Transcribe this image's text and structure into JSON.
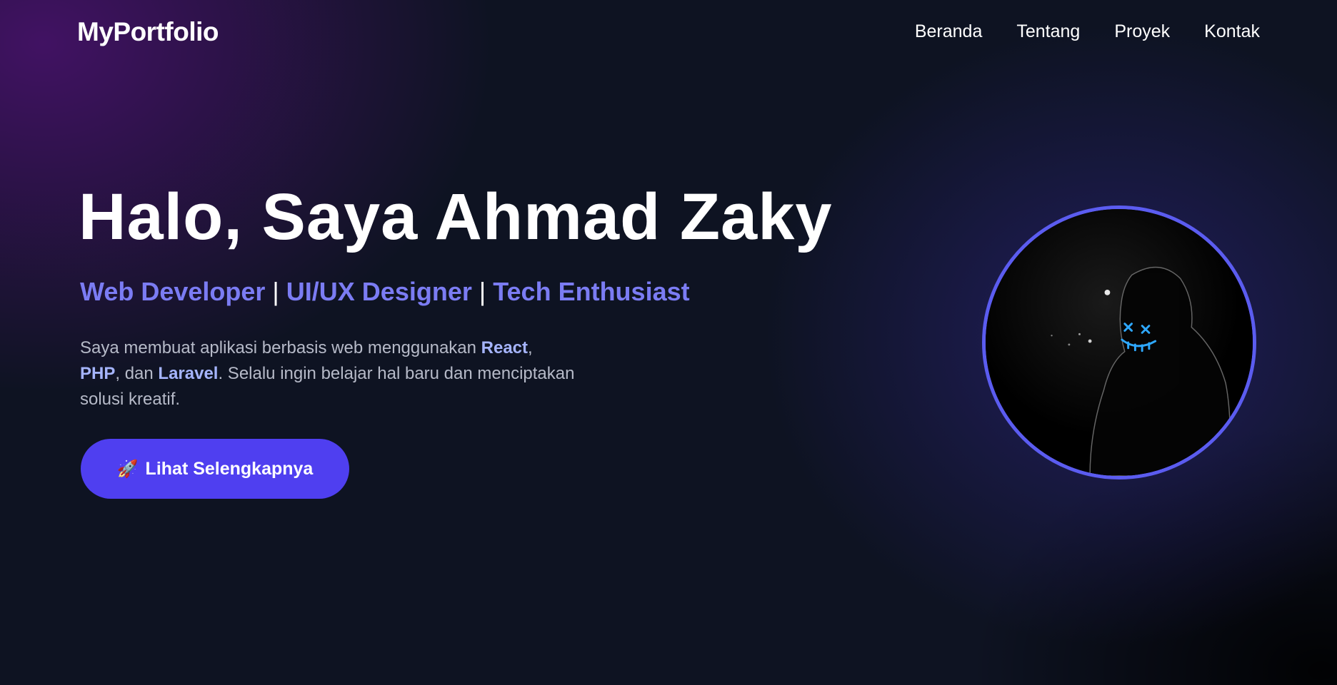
{
  "nav": {
    "brand": "MyPortfolio",
    "links": [
      "Beranda",
      "Tentang",
      "Proyek",
      "Kontak"
    ]
  },
  "hero": {
    "title": "Halo, Saya Ahmad Zaky",
    "roles": [
      "Web Developer",
      "UI/UX Designer",
      "Tech Enthusiast"
    ],
    "separator": "|",
    "description": {
      "part1": "Saya membuat aplikasi berbasis web menggunakan ",
      "tech1": "React",
      "part2": ", ",
      "tech2": "PHP",
      "part3": ", dan ",
      "tech3": "Laravel",
      "part4": ". Selalu ingin belajar hal baru dan menciptakan solusi kreatif."
    },
    "cta_label": "Lihat Selengkapnya",
    "cta_icon": "rocket-icon"
  },
  "colors": {
    "accent": "#4f3ff0",
    "role_text": "#7b7cf3",
    "highlight": "#a5b4fc",
    "avatar_border": "#5b5cf0"
  }
}
